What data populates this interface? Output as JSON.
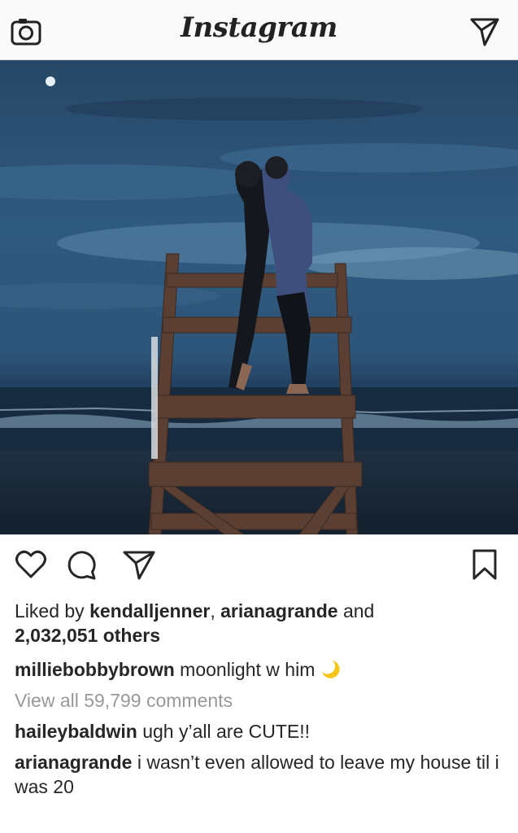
{
  "header": {
    "logo_text": "Instagram",
    "camera_icon": "camera-icon",
    "direct_icon": "paper-plane-icon"
  },
  "post": {
    "actions": {
      "like_icon": "heart-icon",
      "comment_icon": "comment-icon",
      "share_icon": "paper-plane-icon",
      "save_icon": "bookmark-icon"
    },
    "likes": {
      "prefix": "Liked by ",
      "user1": "kendalljenner",
      "sep": ", ",
      "user2": "arianagrande",
      "and": " and",
      "count": "2,032,051 others"
    },
    "caption": {
      "username": "milliebobbybrown",
      "text": " moonlight w him",
      "emoji_icon": "crescent-moon-icon"
    },
    "view_all": "View all 59,799 comments",
    "comments": [
      {
        "username": "haileybaldwin",
        "text": " ugh y’all are CUTE!!"
      },
      {
        "username": "arianagrande",
        "text": " i wasn’t even allowed to leave my house til i was 20"
      }
    ]
  },
  "colors": {
    "text": "#262626",
    "muted": "#999999",
    "moon": "#f5c518"
  }
}
